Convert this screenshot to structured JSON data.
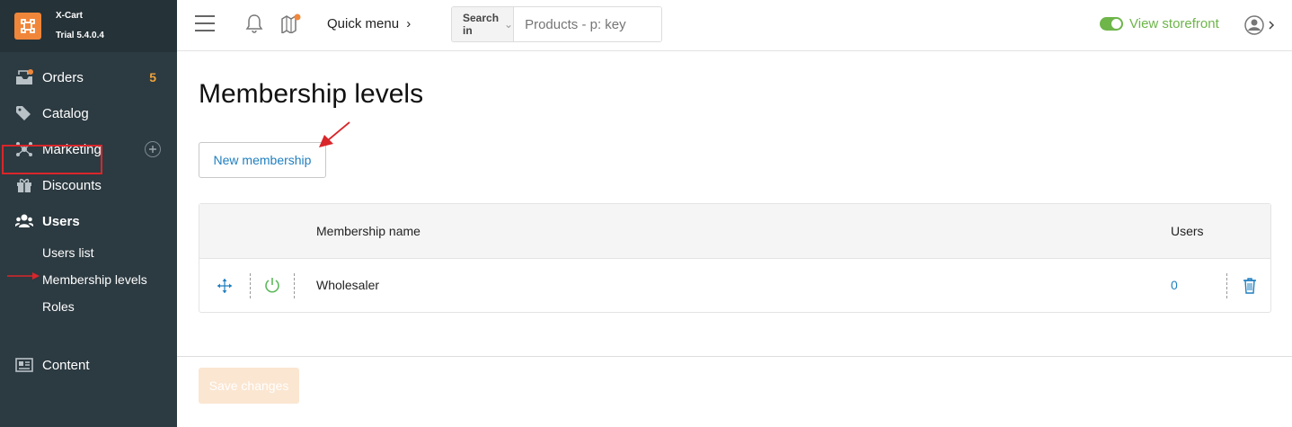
{
  "brand": {
    "name": "X-Cart",
    "version": "Trial 5.4.0.4"
  },
  "sidebar": {
    "items": [
      {
        "label": "Orders",
        "count": "5"
      },
      {
        "label": "Catalog"
      },
      {
        "label": "Marketing"
      },
      {
        "label": "Discounts"
      },
      {
        "label": "Users"
      }
    ],
    "sub_items": [
      "Users list",
      "Membership levels",
      "Roles"
    ],
    "content_label": "Content"
  },
  "topbar": {
    "quick_menu": "Quick menu",
    "search_in": "Search in",
    "search_placeholder": "Products - p: key",
    "storefront": "View storefront"
  },
  "main": {
    "title": "Membership levels",
    "new_button": "New membership",
    "table": {
      "headers": [
        "Membership name",
        "Users"
      ],
      "rows": [
        {
          "name": "Wholesaler",
          "users": "0"
        }
      ]
    },
    "save_button": "Save changes"
  },
  "colors": {
    "accent": "#1f7fbf",
    "orange": "#f0863a",
    "sidebar": "#2c3a41",
    "green": "#6eb54a",
    "annotation": "#d9262a"
  }
}
